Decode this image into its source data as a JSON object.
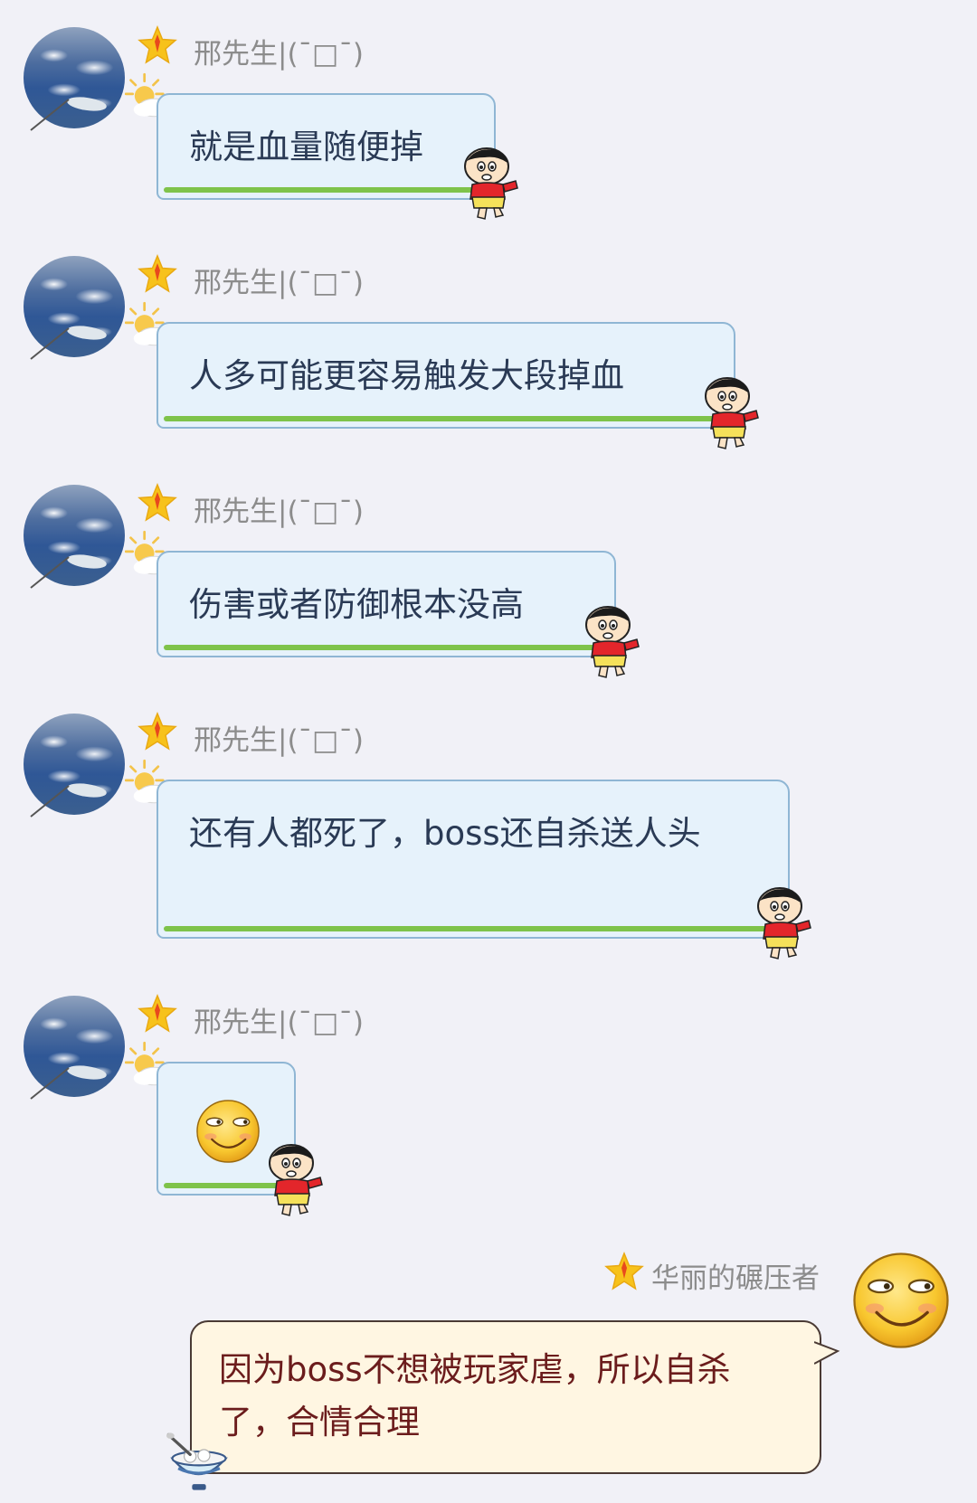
{
  "chat": {
    "messages": [
      {
        "sender": "邢先生|(ˉ□ˉ)",
        "text": "就是血量随便掉"
      },
      {
        "sender": "邢先生|(ˉ□ˉ)",
        "text": "人多可能更容易触发大段掉血"
      },
      {
        "sender": "邢先生|(ˉ□ˉ)",
        "text": "伤害或者防御根本没高"
      },
      {
        "sender": "邢先生|(ˉ□ˉ)",
        "text": "还有人都死了，boss还自杀送人头"
      },
      {
        "sender": "邢先生|(ˉ□ˉ)",
        "emoji": "smirk-face-icon"
      },
      {
        "sender": "华丽的碾压者",
        "text": "因为boss不想被玩家虐，所以自杀了，合情合理"
      }
    ]
  },
  "colors": {
    "background": "#f1f1f7",
    "left_bubble": "#e6f2fb",
    "left_bubble_border": "#8fb6d4",
    "left_bubble_stripe": "#7ec34a",
    "left_text": "#2a3a55",
    "right_bubble": "#fff6e2",
    "right_bubble_border": "#4a3a34",
    "right_text": "#6b1c1c",
    "sender_name": "#8c8c8c"
  }
}
